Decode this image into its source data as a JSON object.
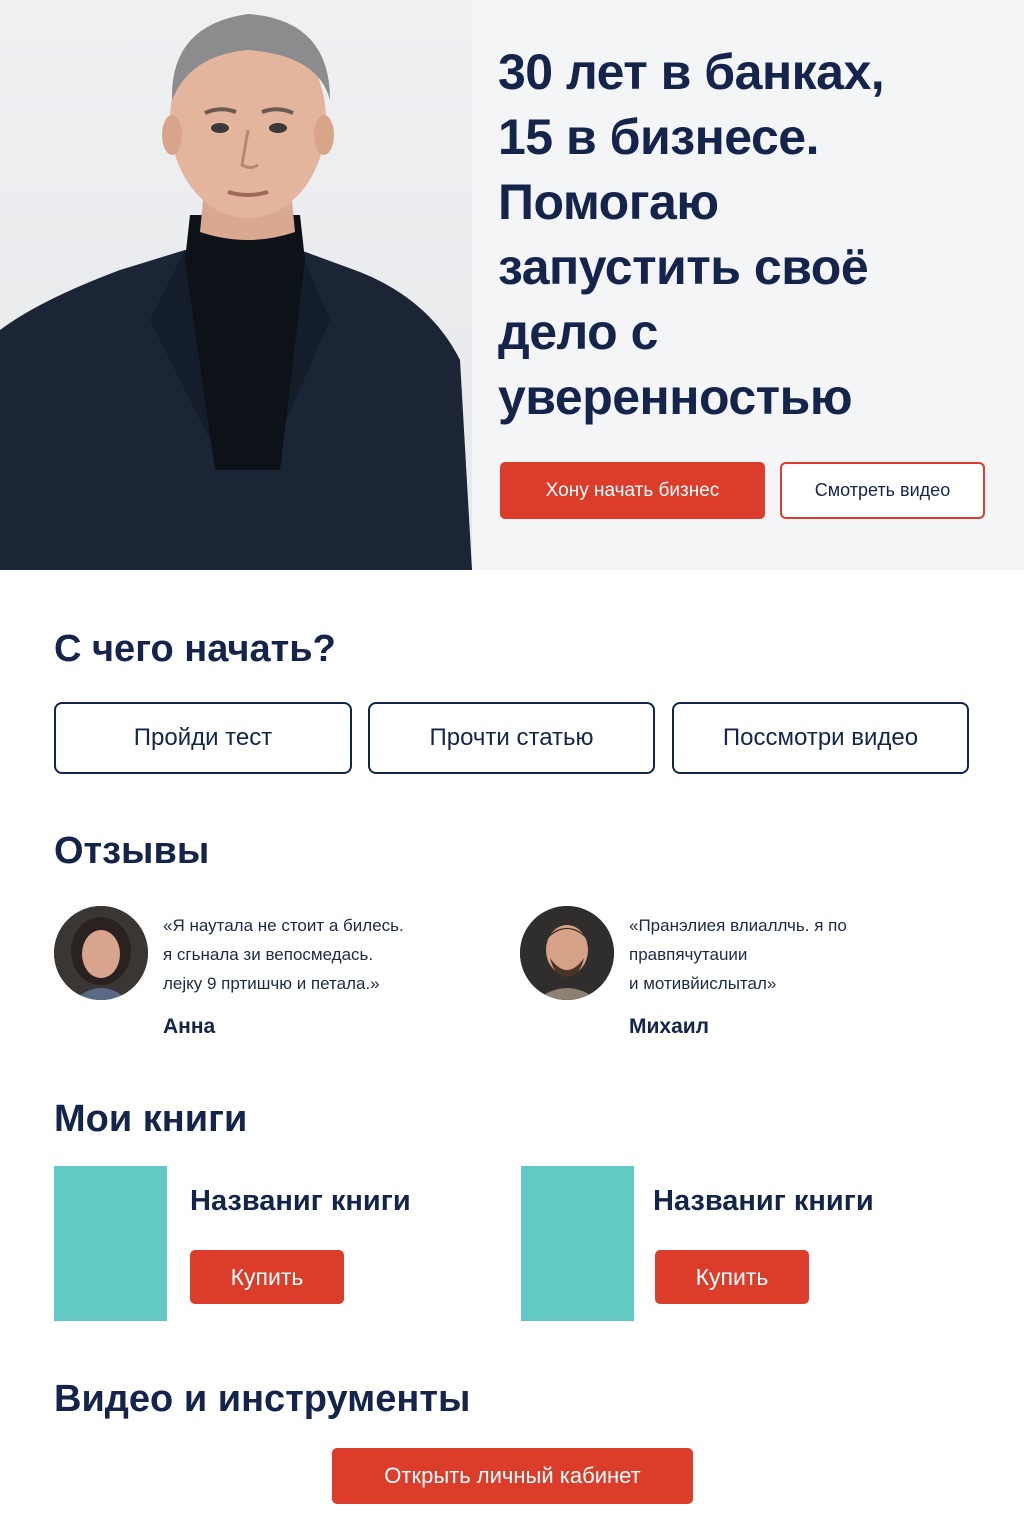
{
  "hero": {
    "title": "30 лет в банках,\n15 в бизнесе.\nПомогаю\nзапустить своё\nдело с\nуверенностью",
    "cta_label": "Хону начать бизнес",
    "video_label": "Смотреть видео"
  },
  "start": {
    "title": "С чего начать?",
    "buttons": [
      "Пройди тест",
      "Прочти статью",
      "Поссмотри видео"
    ]
  },
  "reviews": {
    "title": "Отзывы",
    "items": [
      {
        "text": "«Я наутала не стоит а билесь.\nя сгьнала зи вепосмедась.\nлејку 9 пртишчю и петала.»",
        "name": "Анна"
      },
      {
        "text": "«Пранэлиея влиаллчь. я по\nправпячутаuии\nи мотивйислытал»",
        "name": "Михаил"
      }
    ]
  },
  "books": {
    "title": "Мои книги",
    "items": [
      {
        "title": "Названиг книги",
        "buy_label": "Купить"
      },
      {
        "title": "Названиг книги",
        "buy_label": "Купить"
      }
    ],
    "cover_color": "#62c9c3"
  },
  "tools": {
    "title": "Видео и инструменты",
    "cabinet_label": "Открыть личный кабинет"
  },
  "colors": {
    "accent": "#dc3d2a",
    "navy": "#14244a",
    "teal": "#62c9c3"
  }
}
